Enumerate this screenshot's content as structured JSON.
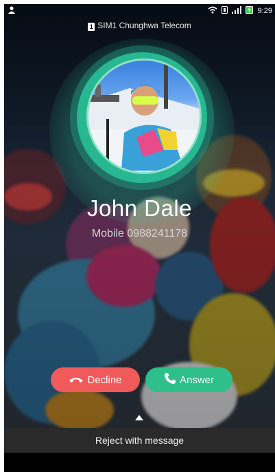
{
  "status_bar": {
    "time": "9:29"
  },
  "sim": {
    "label": "SIM1 Chunghwa Telecom",
    "badge": "1"
  },
  "caller": {
    "name": "John Dale",
    "number": "Mobile 0988241178"
  },
  "actions": {
    "decline_label": "Decline",
    "answer_label": "Answer",
    "reject_message_label": "Reject with message"
  },
  "colors": {
    "accent_green": "#2ebf8a",
    "decline_red": "#f05a5a"
  }
}
